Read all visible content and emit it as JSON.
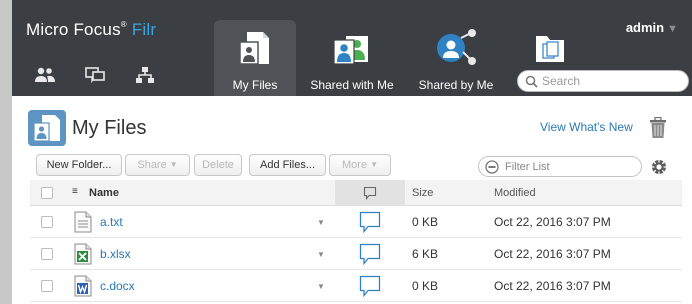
{
  "brand": {
    "name": "Micro Focus",
    "product": "Filr",
    "trademark": "®"
  },
  "nav": {
    "my_files": "My Files",
    "shared_with_me": "Shared with Me",
    "shared_by_me": "Shared by Me",
    "net_folders_icon": "net-folders-icon"
  },
  "left_icons": [
    "people-icon",
    "comments-icon",
    "hierarchy-icon"
  ],
  "user": {
    "name": "admin"
  },
  "search": {
    "placeholder": "Search",
    "value": ""
  },
  "page": {
    "title": "My Files",
    "whats_new": "View What's New"
  },
  "toolbar": {
    "new_folder": "New Folder...",
    "share": "Share",
    "delete": "Delete",
    "add_files": "Add Files...",
    "more": "More"
  },
  "filter": {
    "placeholder": "Filter List",
    "value": ""
  },
  "table": {
    "columns": {
      "name": "Name",
      "size": "Size",
      "modified": "Modified"
    },
    "rows": [
      {
        "name": "a.txt",
        "icon": "text-file-icon",
        "size": "0 KB",
        "modified": "Oct 22, 2016 3:07 PM"
      },
      {
        "name": "b.xlsx",
        "icon": "excel-file-icon",
        "size": "6 KB",
        "modified": "Oct 22, 2016 3:07 PM"
      },
      {
        "name": "c.docx",
        "icon": "word-file-icon",
        "size": "0 KB",
        "modified": "Oct 22, 2016 3:07 PM"
      }
    ]
  },
  "colors": {
    "topbar": "#3b3f44",
    "active_tab": "#4f5357",
    "accent_blue": "#3ba4de",
    "link_blue": "#2a78b6",
    "header_bg": "#f3f3f3"
  }
}
